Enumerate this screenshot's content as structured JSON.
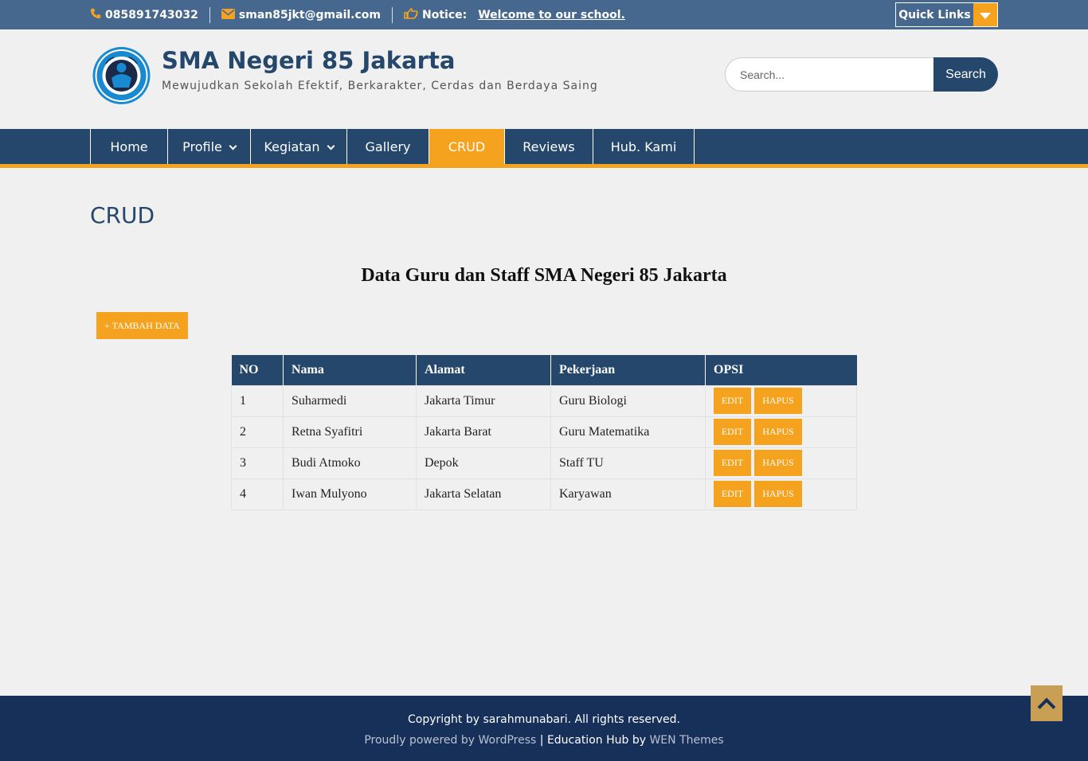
{
  "topbar": {
    "phone": "085891743032",
    "email": "sman85jkt@gmail.com",
    "notice_label": "Notice:",
    "notice_text": "Welcome to our school.",
    "quick_links": "Quick Links"
  },
  "header": {
    "title": "SMA Negeri 85 Jakarta",
    "tagline": "Mewujudkan Sekolah Efektif, Berkarakter, Cerdas dan Berdaya Saing",
    "search_placeholder": "Search...",
    "search_button": "Search"
  },
  "nav": {
    "items": [
      {
        "label": "Home"
      },
      {
        "label": "Profile"
      },
      {
        "label": "Kegiatan"
      },
      {
        "label": "Gallery"
      },
      {
        "label": "CRUD"
      },
      {
        "label": "Reviews"
      },
      {
        "label": "Hub. Kami"
      }
    ],
    "active": "CRUD"
  },
  "content": {
    "page_title": "CRUD",
    "table_title": "Data Guru dan Staff SMA Negeri 85 Jakarta",
    "add_button": "+ TAMBAH DATA",
    "columns": [
      "NO",
      "Nama",
      "Alamat",
      "Pekerjaan",
      "OPSI"
    ],
    "rows": [
      {
        "no": "1",
        "nama": "Suharmedi",
        "alamat": "Jakarta Timur",
        "pekerjaan": "Guru Biologi"
      },
      {
        "no": "2",
        "nama": "Retna Syafitri",
        "alamat": "Jakarta Barat",
        "pekerjaan": "Guru Matematika"
      },
      {
        "no": "3",
        "nama": "Budi Atmoko",
        "alamat": "Depok",
        "pekerjaan": "Staff TU"
      },
      {
        "no": "4",
        "nama": "Iwan Mulyono",
        "alamat": "Jakarta Selatan",
        "pekerjaan": "Karyawan"
      }
    ],
    "edit_label": "EDIT",
    "delete_label": "HAPUS"
  },
  "footer": {
    "copyright": "Copyright by sarahmunabari. All rights reserved.",
    "powered_prefix": "Proudly powered by WordPress",
    "sep": " | ",
    "theme_name": "Education Hub by ",
    "theme_author": "WEN Themes"
  },
  "colors": {
    "primary": "#24476b",
    "accent": "#f5a31f",
    "topbar": "#46688e",
    "footer": "#16305a"
  },
  "icons": {
    "phone": "phone-icon",
    "email": "envelope-icon",
    "notice": "hand-pointer-icon",
    "back_to_top": "chevron-up-icon"
  }
}
